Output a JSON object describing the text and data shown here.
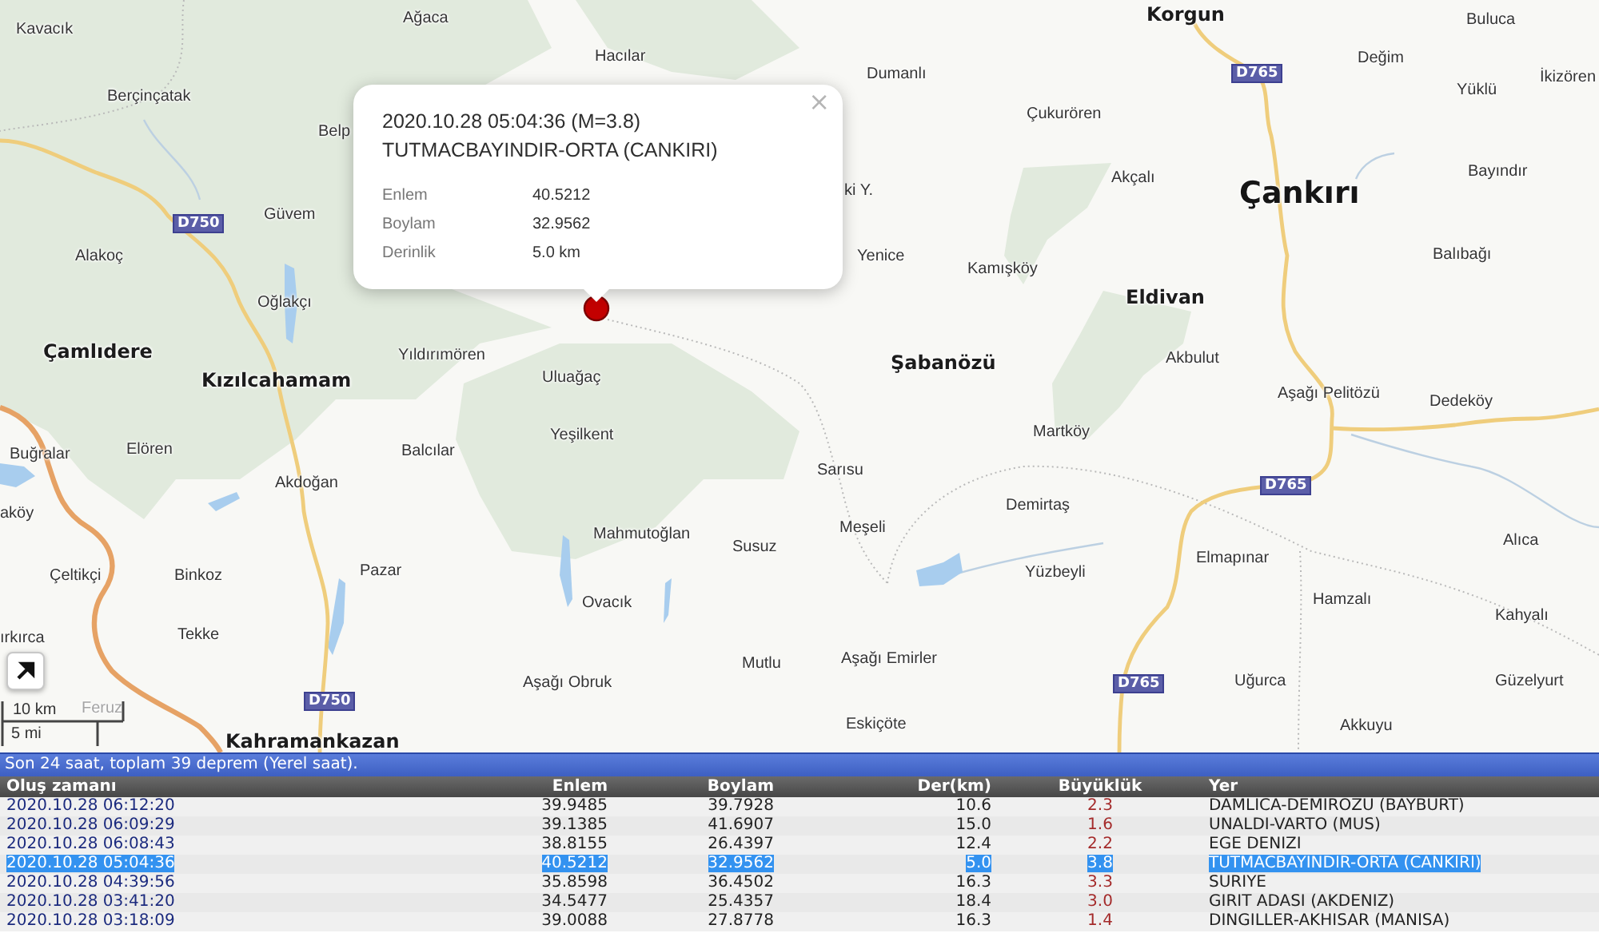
{
  "map": {
    "places": [
      {
        "name": "Ağaca",
        "kind": "village"
      },
      {
        "name": "Korgun",
        "kind": "town"
      },
      {
        "name": "Buluca",
        "kind": "village"
      },
      {
        "name": "Kavacık",
        "kind": "village"
      },
      {
        "name": "Hacılar",
        "kind": "village"
      },
      {
        "name": "Değim",
        "kind": "village"
      },
      {
        "name": "Dumanlı",
        "kind": "village"
      },
      {
        "name": "İkizören",
        "kind": "village"
      },
      {
        "name": "Berçinçatak",
        "kind": "village"
      },
      {
        "name": "Yüklü",
        "kind": "village"
      },
      {
        "name": "Çukurören",
        "kind": "village"
      },
      {
        "name": "Belp",
        "kind": "village"
      },
      {
        "name": "Akçalı",
        "kind": "village"
      },
      {
        "name": "Bayındır",
        "kind": "village"
      },
      {
        "name": "ki Y.",
        "kind": "village"
      },
      {
        "name": "Çankırı",
        "kind": "city"
      },
      {
        "name": "Güvem",
        "kind": "village"
      },
      {
        "name": "Alakoç",
        "kind": "village"
      },
      {
        "name": "Yenice",
        "kind": "village"
      },
      {
        "name": "Balıbağı",
        "kind": "village"
      },
      {
        "name": "Kamışköy",
        "kind": "village"
      },
      {
        "name": "Oğlakçı",
        "kind": "village"
      },
      {
        "name": "Eldivan",
        "kind": "town"
      },
      {
        "name": "Çamlıdere",
        "kind": "town"
      },
      {
        "name": "Yıldırımören",
        "kind": "village"
      },
      {
        "name": "Şabanözü",
        "kind": "town"
      },
      {
        "name": "Akbulut",
        "kind": "village"
      },
      {
        "name": "Kızılcahamam",
        "kind": "town"
      },
      {
        "name": "Uluağaç",
        "kind": "village"
      },
      {
        "name": "Aşağı Pelitözü",
        "kind": "village"
      },
      {
        "name": "Dedeköy",
        "kind": "village"
      },
      {
        "name": "Yeşilkent",
        "kind": "village"
      },
      {
        "name": "Martköy",
        "kind": "village"
      },
      {
        "name": "Buğralar",
        "kind": "village"
      },
      {
        "name": "Elören",
        "kind": "village"
      },
      {
        "name": "Balcılar",
        "kind": "village"
      },
      {
        "name": "Sarısu",
        "kind": "village"
      },
      {
        "name": "Akdoğan",
        "kind": "village"
      },
      {
        "name": "aköy",
        "kind": "village"
      },
      {
        "name": "Demirtaş",
        "kind": "village"
      },
      {
        "name": "Mahmutoğlan",
        "kind": "village"
      },
      {
        "name": "Meşeli",
        "kind": "village"
      },
      {
        "name": "Susuz",
        "kind": "village"
      },
      {
        "name": "Alıca",
        "kind": "village"
      },
      {
        "name": "Elmapınar",
        "kind": "village"
      },
      {
        "name": "Çeltikçi",
        "kind": "village"
      },
      {
        "name": "Binkoz",
        "kind": "village"
      },
      {
        "name": "Pazar",
        "kind": "village"
      },
      {
        "name": "Yüzbeyli",
        "kind": "village"
      },
      {
        "name": "Ovacık",
        "kind": "village"
      },
      {
        "name": "Hamzalı",
        "kind": "village"
      },
      {
        "name": "Kahyalı",
        "kind": "village"
      },
      {
        "name": "ırkırca",
        "kind": "village"
      },
      {
        "name": "Tekke",
        "kind": "village"
      },
      {
        "name": "Mutlu",
        "kind": "village"
      },
      {
        "name": "Aşağı Emirler",
        "kind": "village"
      },
      {
        "name": "Aşağı Obruk",
        "kind": "village"
      },
      {
        "name": "Uğurca",
        "kind": "village"
      },
      {
        "name": "Güzelyurt",
        "kind": "village"
      },
      {
        "name": "Feruz",
        "kind": "muted"
      },
      {
        "name": "Eskiçöte",
        "kind": "village"
      },
      {
        "name": "Akkuyu",
        "kind": "village"
      },
      {
        "name": "Kahramankazan",
        "kind": "town"
      }
    ],
    "road_signs": [
      {
        "label": "D765"
      },
      {
        "label": "D750"
      },
      {
        "label": "D765"
      },
      {
        "label": "D765"
      },
      {
        "label": "D750"
      }
    ],
    "scale": {
      "metric": "10 km",
      "imperial": "5 mi"
    }
  },
  "popup": {
    "title": "2020.10.28 05:04:36 (M=3.8)",
    "location": "TUTMACBAYINDIR-ORTA (CANKIRI)",
    "fields": [
      {
        "label": "Enlem",
        "value": "40.5212"
      },
      {
        "label": "Boylam",
        "value": "32.9562"
      },
      {
        "label": "Derinlik",
        "value": "5.0 km"
      }
    ],
    "close": "×"
  },
  "table": {
    "caption": "Son 24 saat, toplam 39 deprem (Yerel saat).",
    "columns": [
      {
        "label": "Oluş zamanı",
        "kind": "time"
      },
      {
        "label": "Enlem",
        "kind": "number"
      },
      {
        "label": "Boylam",
        "kind": "number"
      },
      {
        "label": "Der(km)",
        "kind": "number"
      },
      {
        "label": "Büyüklük",
        "kind": "magnitude"
      },
      {
        "label": "Yer",
        "kind": "place"
      }
    ],
    "rows": [
      {
        "cells": [
          "2020.10.28 06:12:20",
          "39.9485",
          "39.7928",
          "10.6",
          "2.3",
          "DAMLICA-DEMIROZU (BAYBURT)"
        ],
        "selected": false
      },
      {
        "cells": [
          "2020.10.28 06:09:29",
          "39.1385",
          "41.6907",
          "15.0",
          "1.6",
          "UNALDI-VARTO (MUS)"
        ],
        "selected": false
      },
      {
        "cells": [
          "2020.10.28 06:08:43",
          "38.8155",
          "26.4397",
          "12.4",
          "2.2",
          "EGE DENIZI"
        ],
        "selected": false
      },
      {
        "cells": [
          "2020.10.28 05:04:36",
          "40.5212",
          "32.9562",
          "5.0",
          "3.8",
          "TUTMACBAYINDIR-ORTA (CANKIRI)"
        ],
        "selected": true
      },
      {
        "cells": [
          "2020.10.28 04:39:56",
          "35.8598",
          "36.4502",
          "16.3",
          "3.3",
          "SURIYE"
        ],
        "selected": false
      },
      {
        "cells": [
          "2020.10.28 03:41:20",
          "34.5477",
          "25.4357",
          "18.4",
          "3.0",
          "GIRIT ADASI (AKDENIZ)"
        ],
        "selected": false
      },
      {
        "cells": [
          "2020.10.28 03:18:09",
          "39.0088",
          "27.8778",
          "16.3",
          "1.4",
          "DINGILLER-AKHISAR (MANISA)"
        ],
        "selected": false
      }
    ]
  }
}
